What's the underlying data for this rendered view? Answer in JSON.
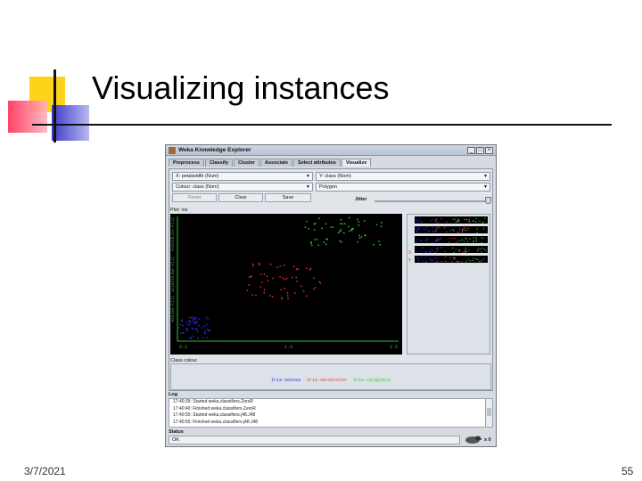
{
  "slide": {
    "title": "Visualizing instances",
    "date": "3/7/2021",
    "page": "55"
  },
  "window": {
    "title": "Weka Knowledge Explorer",
    "tabs": [
      {
        "label": "Preprocess",
        "active": false
      },
      {
        "label": "Classify",
        "active": false
      },
      {
        "label": "Cluster",
        "active": false
      },
      {
        "label": "Associate",
        "active": false
      },
      {
        "label": "Select attributes",
        "active": false
      },
      {
        "label": "Visualize",
        "active": true
      }
    ],
    "controls": {
      "x_axis": "X: petalwidth (Num)",
      "y_axis": "Y: class (Nom)",
      "colour": "Colour: class (Nom)",
      "shape": "Polygon",
      "reset": "Reset",
      "clear": "Clear",
      "save": "Save",
      "jitter": "Jitter"
    },
    "plot": {
      "label": "Plot: iris",
      "y_ticks": [
        "Iris-virginica",
        "Iris-versicolor",
        "Iris-setosa"
      ],
      "x_ticks": [
        "0.1",
        "1.3",
        "2.5"
      ]
    },
    "class_colour": {
      "label": "Class colour",
      "entries": [
        {
          "name": "Iris-setosa",
          "color": "#2a2ae0"
        },
        {
          "name": "Iris-versicolor",
          "color": "#e03030"
        },
        {
          "name": "Iris-virginica",
          "color": "#2fc23a"
        }
      ]
    },
    "side_xy": {
      "x": "X",
      "y": "Y"
    },
    "log": {
      "label": "Log",
      "lines": [
        "17:40:39: Started weka.classifiers.ZeroR",
        "17:40:40: Finished weka.classifiers.ZeroR",
        "17:40:55: Started weka.classifiers.j48.J48",
        "17:40:55: Finished weka.classifiers.j48.J48"
      ]
    },
    "status": {
      "label": "Status",
      "text": "OK",
      "count": "x 0"
    }
  }
}
